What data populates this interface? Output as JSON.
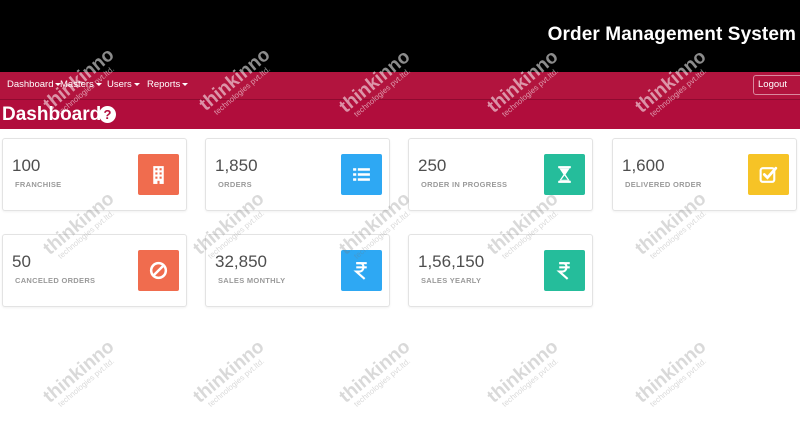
{
  "app": {
    "title": "Order Management System"
  },
  "nav": {
    "items": [
      {
        "label": "Dashboard"
      },
      {
        "label": "Masters"
      },
      {
        "label": "Users"
      },
      {
        "label": "Reports"
      }
    ],
    "logout_label": "Logout"
  },
  "page": {
    "title": "Dashboard",
    "help_glyph": "?"
  },
  "cards": [
    {
      "value": "100",
      "label": "FRANCHISE",
      "icon": "building-icon",
      "color": "#f06c4e"
    },
    {
      "value": "1,850",
      "label": "ORDERS",
      "icon": "list-icon",
      "color": "#2ea8f3"
    },
    {
      "value": "250",
      "label": "ORDER IN PROGRESS",
      "icon": "hourglass-icon",
      "color": "#25bd9b"
    },
    {
      "value": "1,600",
      "label": "DELIVERED ORDER",
      "icon": "checkbox-icon",
      "color": "#f6c326"
    },
    {
      "value": "50",
      "label": "CANCELED ORDERS",
      "icon": "ban-icon",
      "color": "#f06c4e"
    },
    {
      "value": "32,850",
      "label": "SALES MONTHLY",
      "icon": "rupee-icon",
      "color": "#2ea8f3"
    },
    {
      "value": "1,56,150",
      "label": "SALES YEARLY",
      "icon": "rupee-icon",
      "color": "#25bd9b"
    }
  ],
  "watermark": {
    "name": "thinkinno",
    "tagline": "technologies pvt.ltd."
  }
}
